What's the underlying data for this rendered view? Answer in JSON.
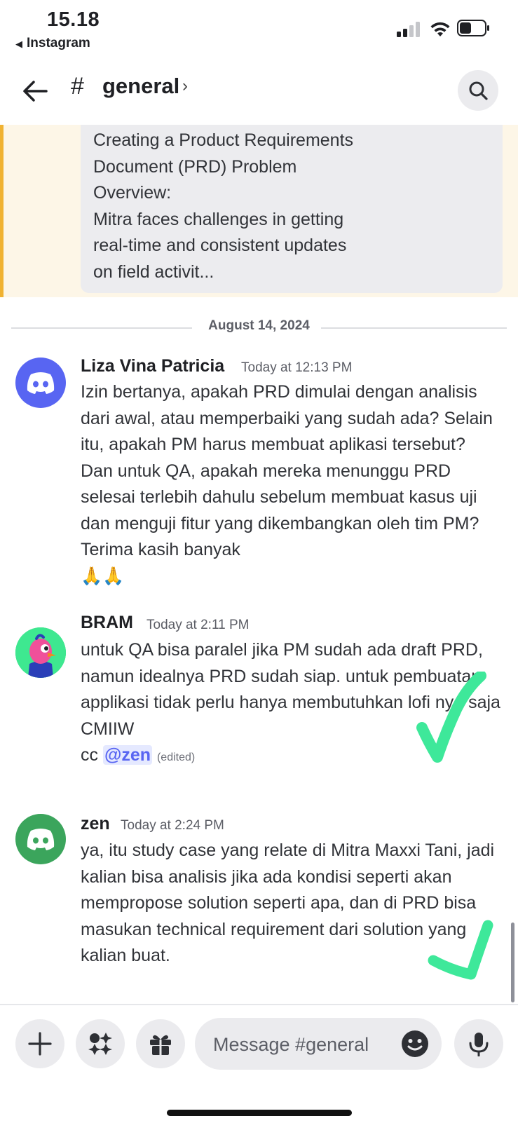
{
  "status_bar": {
    "time": "15.18",
    "back_app": "Instagram",
    "back_arrow_glyph": "◀"
  },
  "header": {
    "hash": "#",
    "channel_name": "general",
    "chevron": "›"
  },
  "pinned_message": {
    "text": "Creating a Product Requirements\nDocument (PRD) Problem\nOverview:\nMitra faces challenges in getting\nreal-time and consistent updates\non field activit..."
  },
  "date_divider": "August 14, 2024",
  "messages": [
    {
      "author": "Liza Vina Patricia",
      "timestamp": "Today at 12:13 PM",
      "avatar_icon": "discord-logo-icon",
      "avatar_color": "#5865f2",
      "text": "Izin bertanya, apakah PRD dimulai dengan analisis dari awal, atau memperbaiki yang sudah ada? Selain itu, apakah PM harus membuat aplikasi tersebut? Dan untuk QA, apakah mereka menunggu PRD selesai terlebih dahulu sebelum membuat kasus uji dan menguji fitur yang dikembangkan oleh tim PM? Terima kasih banyak",
      "emoji": "🙏🙏"
    },
    {
      "author": "BRAM",
      "timestamp": "Today at 2:11 PM",
      "avatar_icon": "bird-character-avatar-icon",
      "avatar_color": "#2ecc71",
      "text": "untuk QA bisa paralel jika PM sudah ada draft PRD, namun idealnya PRD sudah siap. untuk pembuatan applikasi tidak perlu hanya membutuhkan lofi nya saja CMIIW",
      "cc_prefix": "cc ",
      "mention": "@zen",
      "edited": "(edited)"
    },
    {
      "author": "zen",
      "timestamp": "Today at 2:24 PM",
      "avatar_icon": "discord-logo-icon",
      "avatar_color": "#3ba55c",
      "text": "ya, itu study case yang relate di Mitra Maxxi Tani, jadi kalian bisa analisis jika ada kondisi seperti akan mempropose solution seperti apa, dan di PRD bisa masukan technical requirement dari solution yang kalian buat."
    }
  ],
  "annotations": {
    "checkmark_color": "#3ee89a"
  },
  "composer": {
    "placeholder": "Message #general"
  },
  "colors": {
    "pinned_accent": "#f0b232",
    "mention_blue": "#5865f2"
  }
}
